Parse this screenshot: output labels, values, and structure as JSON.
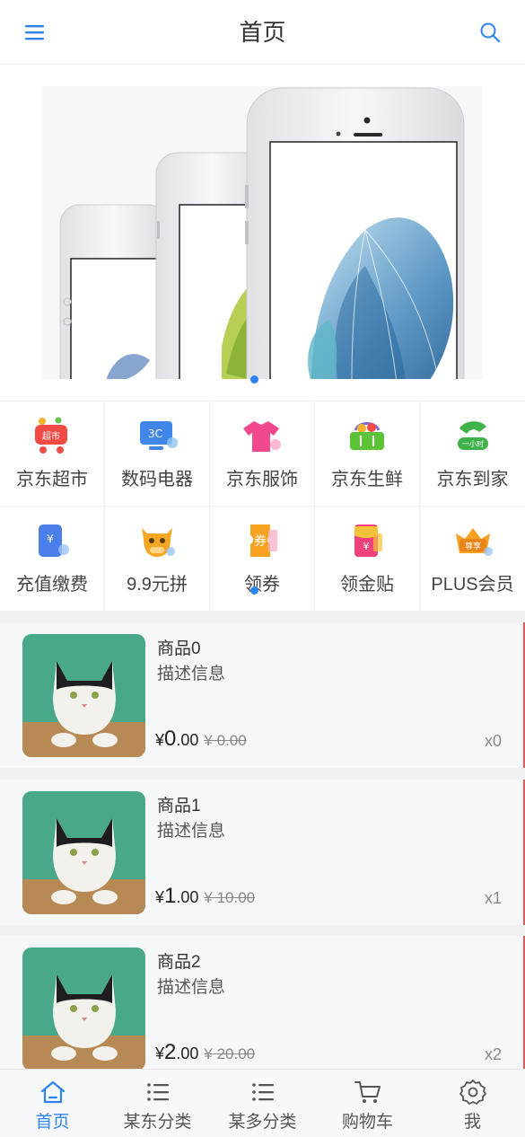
{
  "header": {
    "title": "首页",
    "menu_icon": "menu-icon",
    "search_icon": "search-icon"
  },
  "banner": {
    "slides": 1,
    "active_slide": 0
  },
  "grid": {
    "items": [
      {
        "label": "京东超市",
        "icon": "supermarket-cart-icon",
        "badge": "超市"
      },
      {
        "label": "数码电器",
        "icon": "digital-3c-icon",
        "badge": "3C"
      },
      {
        "label": "京东服饰",
        "icon": "tshirt-icon"
      },
      {
        "label": "京东生鲜",
        "icon": "fresh-basket-icon"
      },
      {
        "label": "京东到家",
        "icon": "delivery-hour-icon",
        "badge": "一小时"
      },
      {
        "label": "充值缴费",
        "icon": "recharge-card-icon",
        "badge": "¥"
      },
      {
        "label": "9.9元拼",
        "icon": "cow-group-icon"
      },
      {
        "label": "领券",
        "icon": "coupon-icon",
        "badge": "券"
      },
      {
        "label": "领金贴",
        "icon": "red-envelope-icon",
        "badge": "¥"
      },
      {
        "label": "PLUS会员",
        "icon": "crown-icon",
        "badge": "尊享"
      }
    ]
  },
  "products": [
    {
      "name": "商品0",
      "desc": "描述信息",
      "price_int": "0",
      "price_dec": ".00",
      "currency": "¥",
      "orig_price": "¥ 0.00",
      "qty": "x0"
    },
    {
      "name": "商品1",
      "desc": "描述信息",
      "price_int": "1",
      "price_dec": ".00",
      "currency": "¥",
      "orig_price": "¥ 10.00",
      "qty": "x1"
    },
    {
      "name": "商品2",
      "desc": "描述信息",
      "price_int": "2",
      "price_dec": ".00",
      "currency": "¥",
      "orig_price": "¥ 20.00",
      "qty": "x2"
    }
  ],
  "tabbar": {
    "tabs": [
      {
        "label": "首页",
        "icon": "home-icon",
        "active": true
      },
      {
        "label": "某东分类",
        "icon": "list-icon",
        "active": false
      },
      {
        "label": "某多分类",
        "icon": "list-icon",
        "active": false
      },
      {
        "label": "购物车",
        "icon": "cart-icon",
        "active": false
      },
      {
        "label": "我",
        "icon": "gear-icon",
        "active": false
      }
    ]
  },
  "colors": {
    "accent": "#2b84f0",
    "price_strike": "#888888",
    "list_bg": "#f0f1f4"
  }
}
